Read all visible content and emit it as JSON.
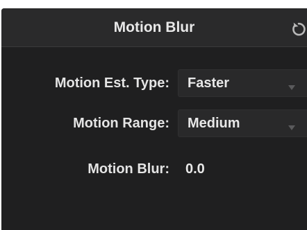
{
  "panel": {
    "title": "Motion Blur",
    "reset_icon": "reset-icon"
  },
  "rows": [
    {
      "label": "Motion Est. Type:",
      "value": "Faster",
      "control": "select"
    },
    {
      "label": "Motion Range:",
      "value": "Medium",
      "control": "select"
    },
    {
      "label": "Motion Blur:",
      "value": "0.0",
      "control": "text"
    }
  ],
  "colors": {
    "panel_background": "#1f1f20",
    "header_background": "#2a2a2b",
    "select_background": "#29292a",
    "text": "#e6e6e6",
    "chevron": "#5a5a5c"
  }
}
